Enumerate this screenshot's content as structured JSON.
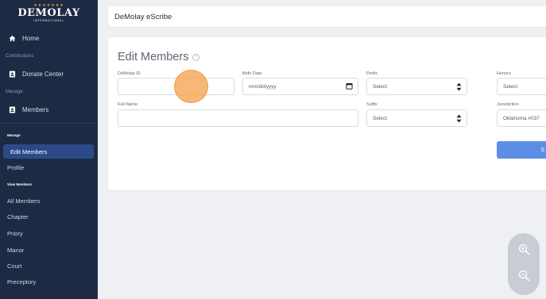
{
  "app": {
    "logo_main": "DeMolay",
    "logo_sub": "INTERNATIONAL",
    "logo_stars": "★★★★★★★"
  },
  "sidebar": {
    "home_label": "Home",
    "contributions_label": "Contributions",
    "donate_label": "Donate Center",
    "manage_label": "Manage",
    "members_label": "Members",
    "manage_bold_label": "Manage",
    "edit_members_label": "Edit Members",
    "profile_label": "Profile",
    "view_members_label": "View Members",
    "items": [
      "All Members",
      "Chapter",
      "Priory",
      "Manor",
      "Court",
      "Preceptory"
    ]
  },
  "topbar": {
    "title": "DeMolay eScribe"
  },
  "form": {
    "title": "Edit Members",
    "demolay_id_label": "DeMolay ID",
    "demolay_id_value": "",
    "birth_date_label": "Birth Date",
    "birth_date_placeholder": "mm/dd/yyyy",
    "prefix_label": "Prefix",
    "prefix_value": "Select",
    "honors_label": "Honors",
    "honors_value": "Select",
    "full_name_label": "Full Name",
    "full_name_value": "",
    "suffix_label": "Suffix",
    "suffix_value": "Select",
    "jurisdiction_label": "Jurisdiction",
    "jurisdiction_value": "Oklahoma #037",
    "save_label": "S"
  },
  "colors": {
    "sidebar_bg": "#1d2a44",
    "active_item_bg": "#2c4a8a",
    "accent_button": "#5d8ee6",
    "click_indicator": "#f6a350"
  }
}
